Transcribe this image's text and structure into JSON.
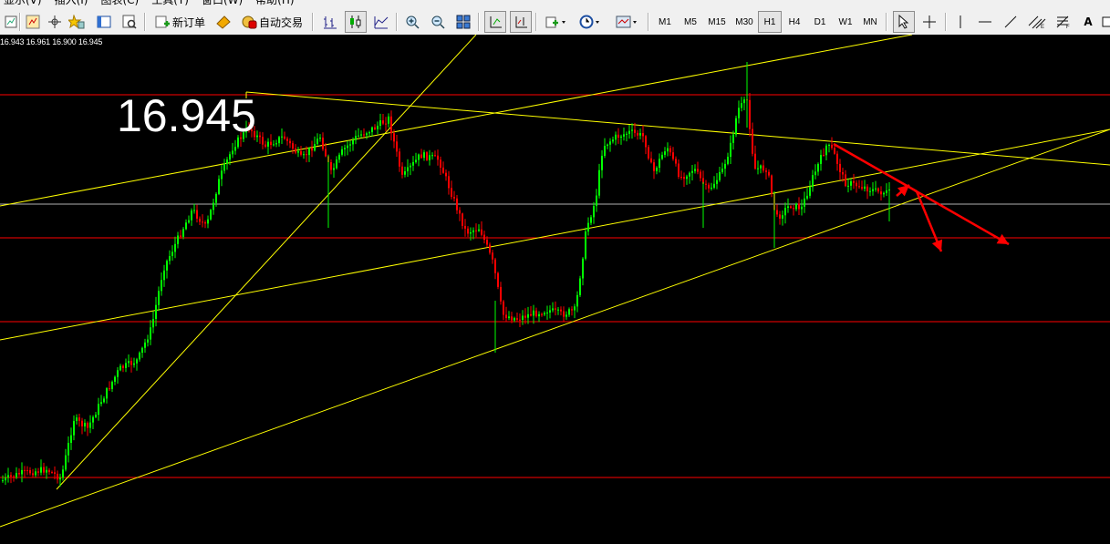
{
  "menu": [
    "显示(V)",
    "插入(I)",
    "图表(C)",
    "工具(T)",
    "窗口(W)",
    "帮助(H)"
  ],
  "toolbar": {
    "new_order_label": "新订单",
    "auto_trade_label": "自动交易",
    "timeframes": [
      "M1",
      "M5",
      "M15",
      "M30",
      "H1",
      "H4",
      "D1",
      "W1",
      "MN"
    ],
    "active_timeframe": "H1",
    "text_tool_label": "A"
  },
  "chart": {
    "ohlc_readout": "16.943 16.961 16.900 16.945",
    "current_price_label": "16.945",
    "background": "#000000",
    "bull_color": "#00ff00",
    "bear_color": "#ff0000",
    "horizontal_level_color": "#ff0000",
    "trendline_color": "#ffff00",
    "arrow_color": "#ff0000"
  }
}
